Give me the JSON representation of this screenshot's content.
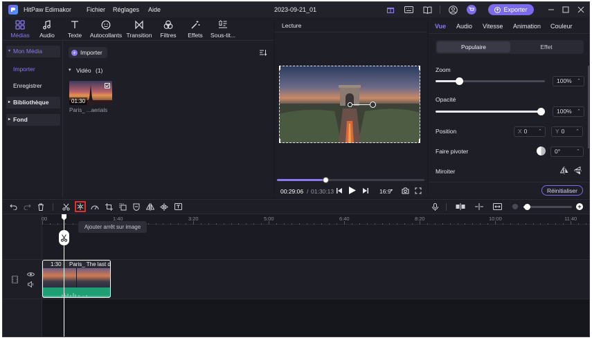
{
  "titlebar": {
    "app_name": "HitPaw Edimakor",
    "menu": [
      "Fichier",
      "Réglages",
      "Aide"
    ],
    "project_name": "2023-09-21_01",
    "export_label": "Exporter"
  },
  "media_tabs": [
    "Médias",
    "Audio",
    "Texte",
    "Autocollants",
    "Transition",
    "Filtres",
    "Effets",
    "Sous-tit..."
  ],
  "sidebar": {
    "my_media": "Mon Média",
    "import": "Importer",
    "record": "Enregistrer",
    "library": "Bibliothèque",
    "background": "Fond"
  },
  "media": {
    "import_button": "Importer",
    "folder_label": "Vidéo",
    "folder_count": "(1)",
    "clip_duration": "01:30",
    "clip_name": "Paris_ ...aerials"
  },
  "player": {
    "title": "Lecture",
    "current_time": "00:29:06",
    "separator": "/",
    "total_time": "01:30:13",
    "aspect_ratio": "16:9",
    "progress": 0.33
  },
  "properties": {
    "tabs": [
      "Vue",
      "Audio",
      "Vitesse",
      "Animation",
      "Couleur"
    ],
    "active_tab": "Vue",
    "subtabs": [
      "Populaire",
      "Effet"
    ],
    "zoom_label": "Zoom",
    "zoom_value": "100%",
    "zoom_level": 0.2,
    "opacity_label": "Opacité",
    "opacity_value": "100%",
    "opacity_level": 1.0,
    "position_label": "Position",
    "pos_x_label": "X",
    "pos_x": "0",
    "pos_y_label": "Y",
    "pos_y": "0",
    "rotate_label": "Faire pivoter",
    "rotate_value": "0°",
    "mirror_label": "Miroiter",
    "reset_label": "Réinitialiser"
  },
  "timeline": {
    "tooltip": "Ajouter arrêt sur image",
    "ticks": [
      "00",
      "1:40",
      "3:20",
      "5:00",
      "6:40",
      "8:20",
      "10:00",
      "11:40"
    ],
    "clip_duration": "1:30",
    "clip_title": "Paris_ The last d"
  },
  "colors": {
    "accent": "#8a78f0",
    "export_bg": "#7b6bea",
    "highlight_red": "#e0302a",
    "audio_green": "#1f9d73"
  }
}
